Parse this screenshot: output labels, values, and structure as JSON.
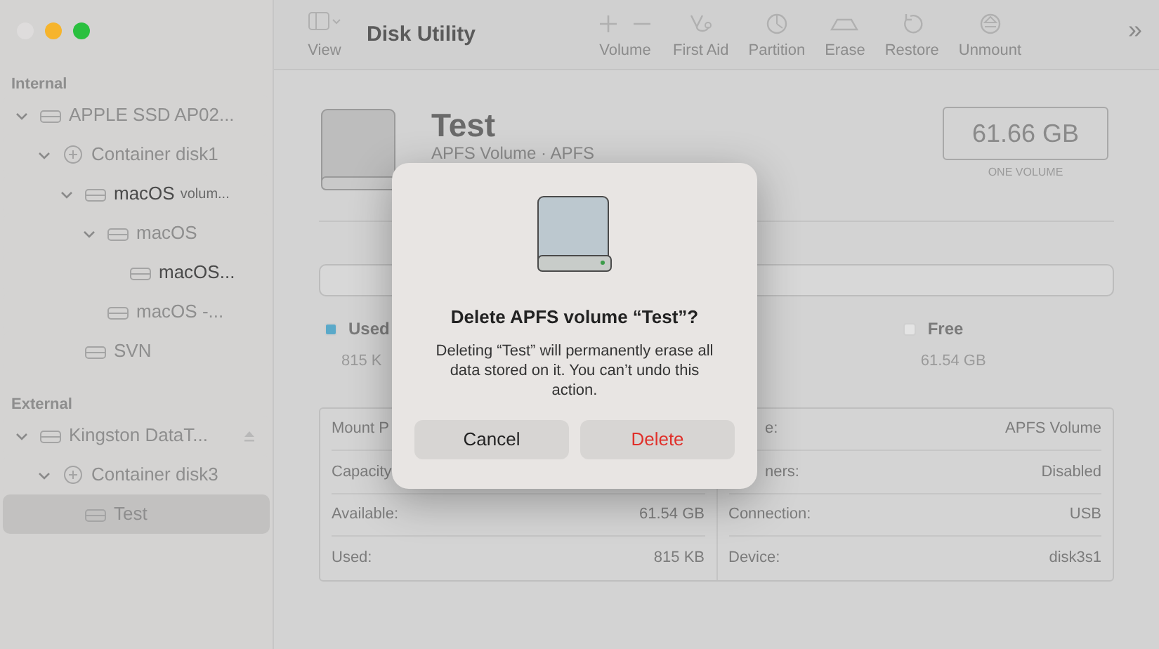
{
  "window": {
    "title": "Disk Utility"
  },
  "sidebar": {
    "sections": [
      {
        "heading": "Internal",
        "items": [
          {
            "label": "APPLE SSD AP02...",
            "dimmed": true,
            "expanded": true,
            "selected": false,
            "children": [
              {
                "label": "Container disk1",
                "dimmed": true,
                "expanded": true,
                "selected": false,
                "children": [
                  {
                    "label": "macOS",
                    "detail": "volum...",
                    "dimmed": false,
                    "expanded": true,
                    "selected": false,
                    "children": [
                      {
                        "label": "macOS",
                        "dimmed": true,
                        "expanded": true,
                        "selected": false,
                        "children": [
                          {
                            "label": "macOS...",
                            "dimmed": false,
                            "selected": false
                          }
                        ]
                      },
                      {
                        "label": "macOS -...",
                        "dimmed": true,
                        "selected": false
                      }
                    ]
                  },
                  {
                    "label": "SVN",
                    "dimmed": true,
                    "selected": false
                  }
                ]
              }
            ]
          }
        ]
      },
      {
        "heading": "External",
        "items": [
          {
            "label": "Kingston DataT...",
            "dimmed": true,
            "expanded": true,
            "selected": false,
            "eject": true,
            "children": [
              {
                "label": "Container disk3",
                "dimmed": true,
                "expanded": true,
                "selected": false,
                "children": [
                  {
                    "label": "Test",
                    "dimmed": true,
                    "selected": true
                  }
                ]
              }
            ]
          }
        ]
      }
    ]
  },
  "toolbar": {
    "view_label": "View",
    "overflow": "»",
    "buttons": [
      {
        "kind": "volume",
        "label": "Volume"
      },
      {
        "kind": "firstaid",
        "label": "First Aid"
      },
      {
        "kind": "partition",
        "label": "Partition"
      },
      {
        "kind": "erase",
        "label": "Erase"
      },
      {
        "kind": "restore",
        "label": "Restore"
      },
      {
        "kind": "unmount",
        "label": "Unmount"
      }
    ]
  },
  "volume": {
    "name": "Test",
    "subtitle": "APFS Volume · APFS",
    "capacity": "61.66 GB",
    "capacity_caption": "ONE VOLUME",
    "legend": [
      {
        "label": "Used",
        "value": "815 K",
        "color": "#5aa9c9"
      },
      {
        "label": "Free",
        "value": "61.54 GB",
        "color": "#e4e4e4"
      }
    ]
  },
  "info": {
    "left": [
      {
        "label": "Mount P"
      },
      {
        "label": "Capacity"
      },
      {
        "label": "Available:",
        "value": "61.54 GB"
      },
      {
        "label": "Used:",
        "value": "815 KB"
      }
    ],
    "right": [
      {
        "label": "e:",
        "value": "APFS Volume",
        "kind": "partial"
      },
      {
        "label": "ners:",
        "value": "Disabled",
        "kind": "partial"
      },
      {
        "label": "Connection:",
        "value": "USB",
        "kind": "full"
      },
      {
        "label": "Device:",
        "value": "disk3s1",
        "kind": "full"
      }
    ]
  },
  "dialog": {
    "title": "Delete APFS volume “Test”?",
    "message": "Deleting “Test” will permanently erase all data stored on it. You can’t undo this action.",
    "buttons": [
      {
        "kind": "cancel",
        "label": "Cancel"
      },
      {
        "kind": "destructive",
        "label": "Delete"
      }
    ]
  }
}
